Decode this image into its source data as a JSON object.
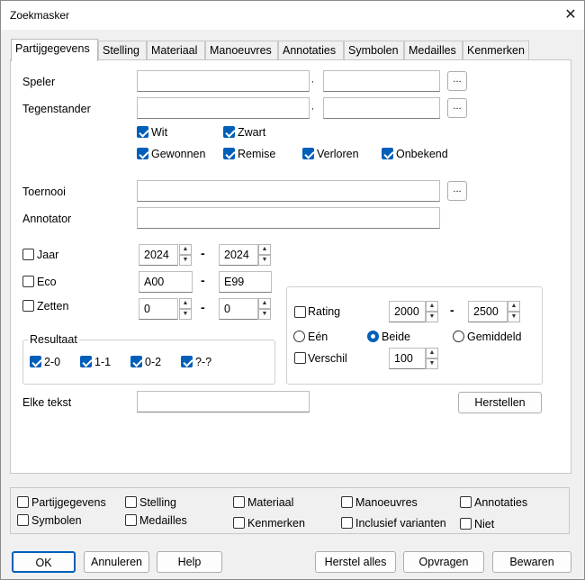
{
  "window": {
    "title": "Zoekmasker",
    "close": "✕"
  },
  "tabs": [
    "Partijgegevens",
    "Stelling",
    "Materiaal",
    "Manoeuvres",
    "Annotaties",
    "Symbolen",
    "Medailles",
    "Kenmerken"
  ],
  "labels": {
    "speler": "Speler",
    "tegenstander": "Tegenstander",
    "toernooi": "Toernooi",
    "annotator": "Annotator",
    "elke_tekst": "Elke tekst"
  },
  "fields": {
    "speler_1": "",
    "speler_2": "",
    "tegenstander_1": "",
    "tegenstander_2": "",
    "toernooi": "",
    "annotator": "",
    "elke_tekst": "",
    "ellipsis": "..."
  },
  "colors": {
    "wit": {
      "label": "Wit",
      "checked": true
    },
    "zwart": {
      "label": "Zwart",
      "checked": true
    }
  },
  "outcome": {
    "gewonnen": {
      "label": "Gewonnen",
      "checked": true
    },
    "remise": {
      "label": "Remise",
      "checked": true
    },
    "verloren": {
      "label": "Verloren",
      "checked": true
    },
    "onbekend": {
      "label": "Onbekend",
      "checked": true
    }
  },
  "ranges": {
    "jaar": {
      "label": "Jaar",
      "from": "2024",
      "to": "2024"
    },
    "eco": {
      "label": "Eco",
      "from": "A00",
      "to": "E99"
    },
    "zetten": {
      "label": "Zetten",
      "from": "0",
      "to": "0"
    },
    "dash": "-"
  },
  "rating": {
    "label": "Rating",
    "from": "2000",
    "to": "2500",
    "een": "Eén",
    "beide": "Beide",
    "gemiddeld": "Gemiddeld",
    "verschil": "Verschil",
    "verschil_value": "100"
  },
  "resultaat": {
    "title": "Resultaat",
    "items": [
      "2-0",
      "1-1",
      "0-2",
      "?-?"
    ]
  },
  "herstellen": "Herstellen",
  "bottom_checks": {
    "partijgegevens": "Partijgegevens",
    "stelling": "Stelling",
    "materiaal": "Materiaal",
    "manoeuvres": "Manoeuvres",
    "annotaties": "Annotaties",
    "symbolen": "Symbolen",
    "medailles": "Medailles",
    "kenmerken": "Kenmerken",
    "inclusief": "Inclusief varianten",
    "niet": "Niet"
  },
  "buttons": {
    "ok": "OK",
    "annuleren": "Annuleren",
    "help": "Help",
    "herstel_alles": "Herstel alles",
    "opvragen": "Opvragen",
    "bewaren": "Bewaren"
  },
  "accent": "#005fb8"
}
